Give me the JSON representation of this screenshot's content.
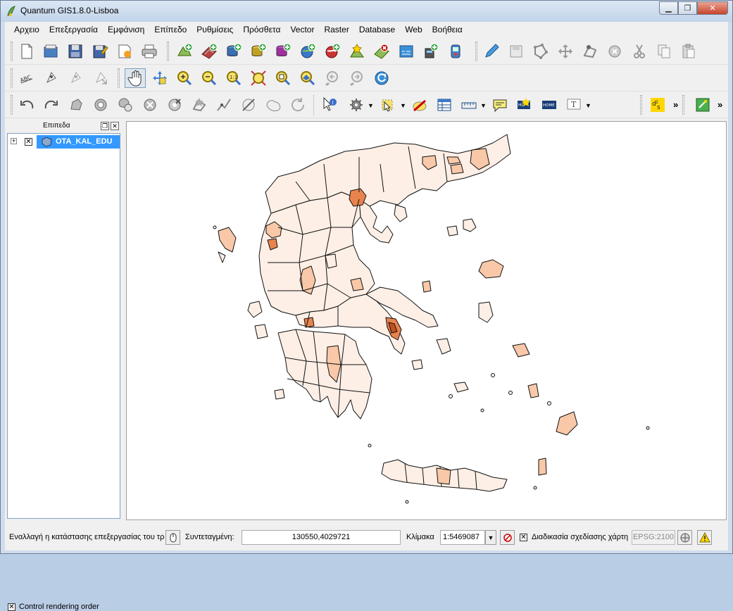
{
  "window": {
    "title": "Quantum GIS1.8.0-Lisboa"
  },
  "menu": [
    "Αρχειο",
    "Επεξεργασία",
    "Εμφάνιση",
    "Επίπεδο",
    "Ρυθμίσεις",
    "Πρόσθετα",
    "Vector",
    "Raster",
    "Database",
    "Web",
    "Βοήθεια"
  ],
  "toolbar_overflow": "»",
  "layers_panel": {
    "title": "Επιπεδα",
    "layer_name": "OTA_KAL_EDU",
    "layer_visible": true,
    "render_order_label": "Control rendering order",
    "render_order_checked": true
  },
  "statusbar": {
    "message": "Εναλλαγή η κατάστασης επεξεργασίας του τρ",
    "coord_label": "Συντεταγμένη:",
    "coord_value": "130550,4029721",
    "scale_label": "Κλίμακα",
    "scale_value": "1:5469087",
    "render_label": "Διαδικασία σχεδίασης χάρτη",
    "render_checked": true,
    "epsg": "EPSG:2100"
  },
  "colors": {
    "polygon_light": "#fdefe6",
    "polygon_mid": "#f8c8a8",
    "polygon_dark": "#e8834e",
    "selection": "#3399ff"
  }
}
